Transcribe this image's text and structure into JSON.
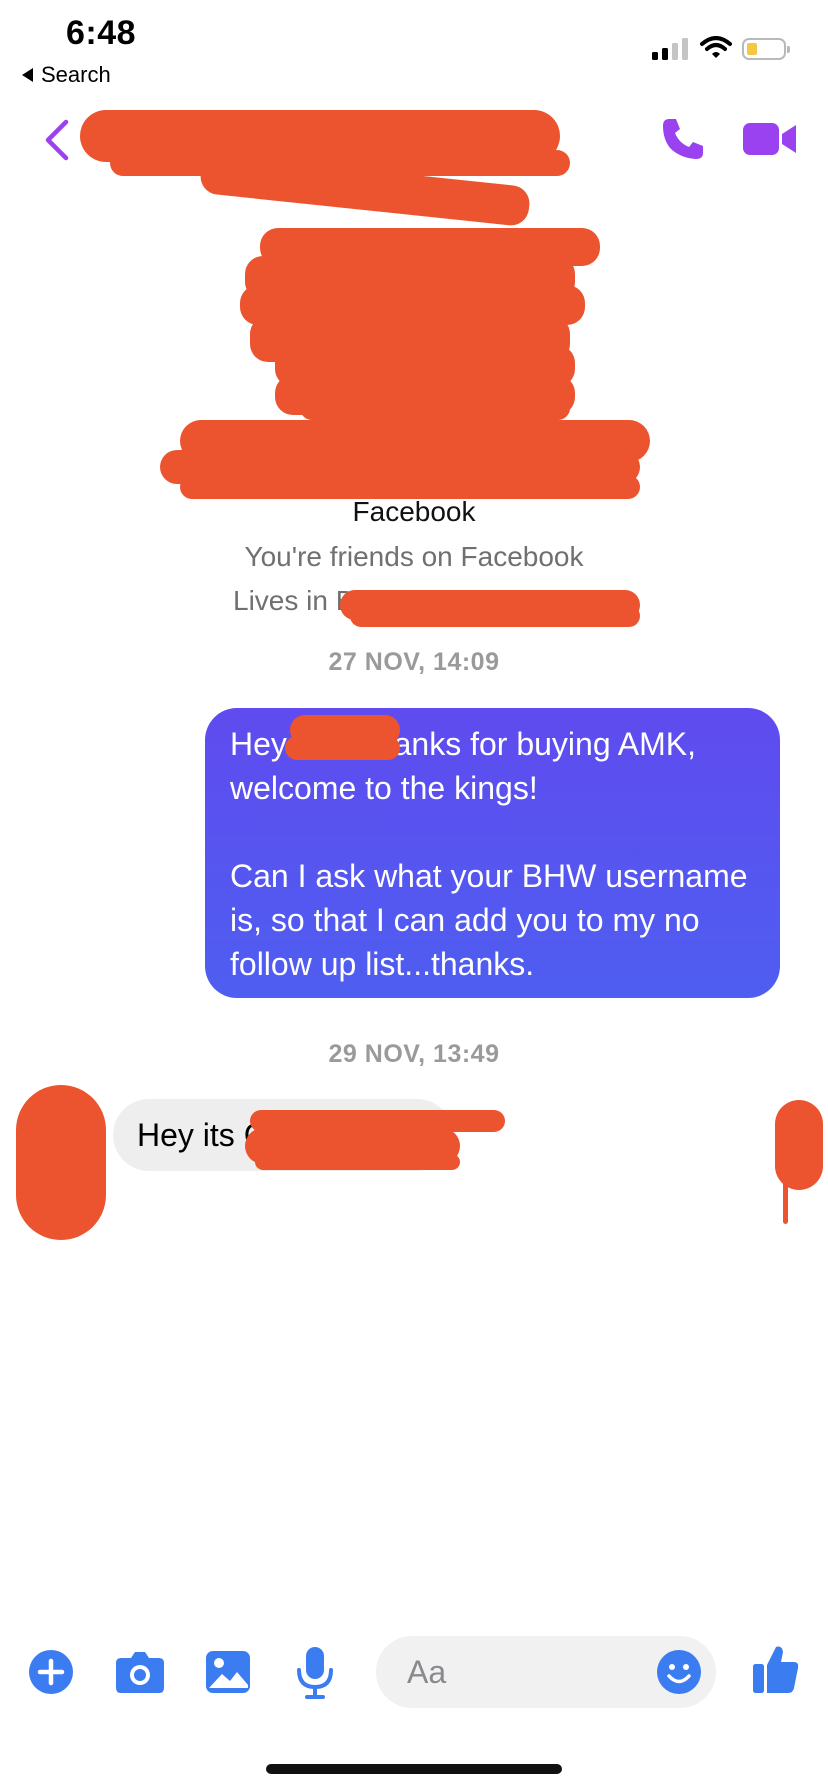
{
  "status_bar": {
    "time": "6:48",
    "back_to_app_label": "Search",
    "icons": [
      "cellular-signal-icon",
      "wifi-icon",
      "battery-icon"
    ]
  },
  "header": {
    "contact_name": "",
    "icons": [
      "chevron-left-icon",
      "phone-icon",
      "video-camera-icon"
    ],
    "accent_color": "#9b42f0"
  },
  "profile": {
    "platform_line": "Facebook",
    "friends_line": "You're friends on Facebook",
    "lives_line": "Lives in Br"
  },
  "messages": [
    {
      "timestamp": "27 NOV, 14:09",
      "direction": "outgoing",
      "text": "Hey       , thanks for buying AMK, welcome to the kings!\n\nCan I ask what your BHW username is, so that I can add you to my no follow up list...thanks."
    },
    {
      "timestamp": "29 NOV, 13:49",
      "direction": "incoming",
      "text": "Hey its C"
    }
  ],
  "composer": {
    "placeholder": "Aa",
    "icons": [
      "plus-circle-icon",
      "camera-icon",
      "image-icon",
      "microphone-icon",
      "smiley-icon",
      "thumbs-up-icon"
    ],
    "accent_color": "#3b7cf0"
  },
  "colors": {
    "outgoing_bubble": "#5a50ef",
    "incoming_bubble": "#eeeeef",
    "redaction": "#ec5430"
  }
}
